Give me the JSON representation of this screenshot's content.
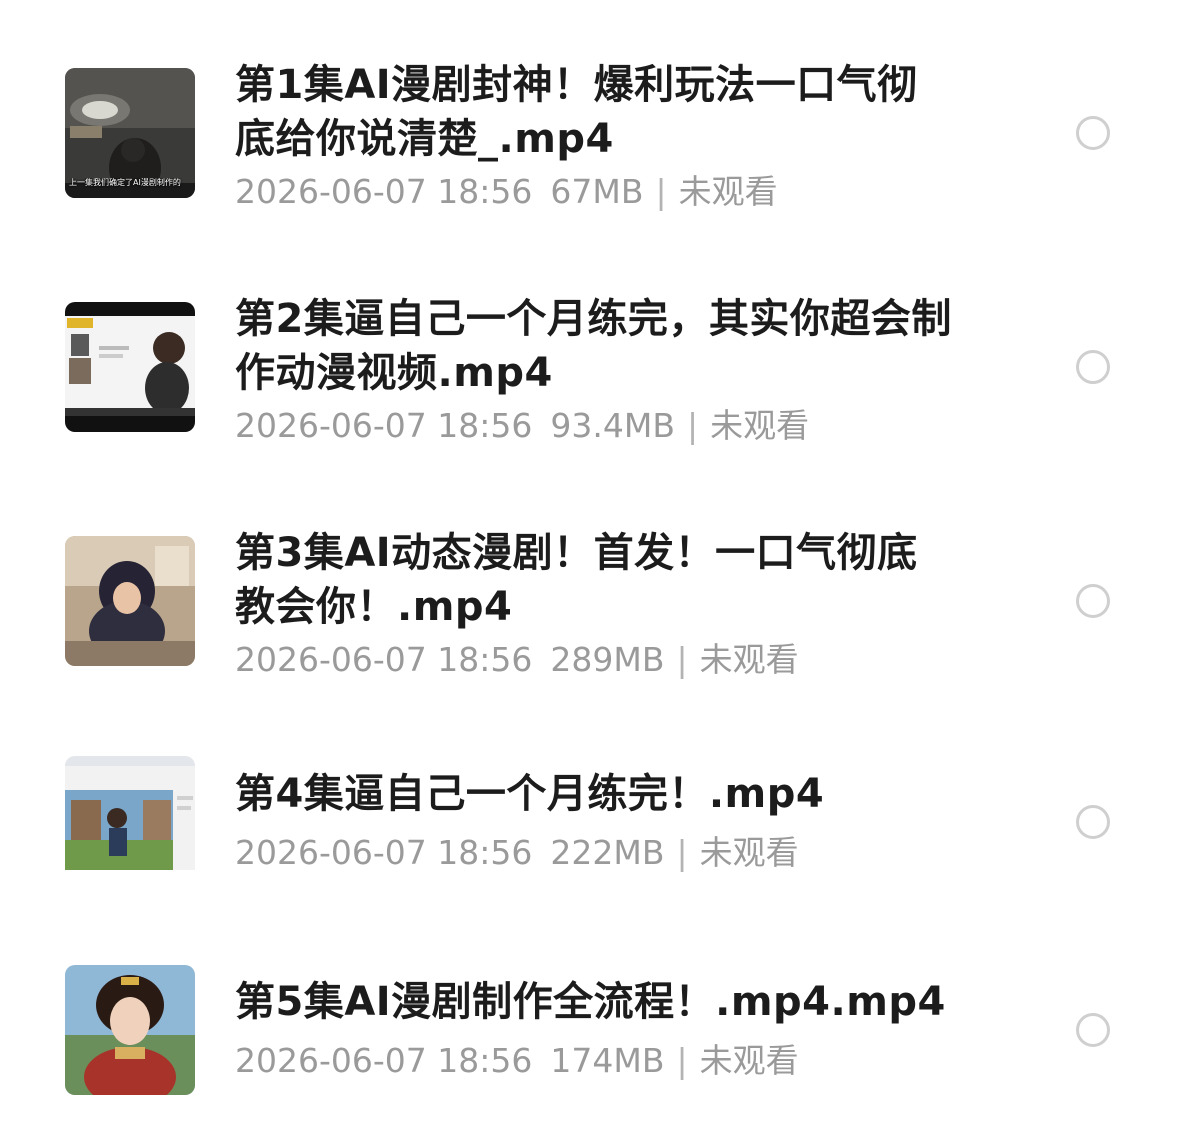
{
  "files": [
    {
      "title": "第1集AI漫剧封神！爆利玩法一口气彻底给你说清楚_.mp4",
      "date": "2026-06-07 18:56",
      "size": "67MB",
      "separator": "|",
      "status": "未观看",
      "thumb_caption": "上一集我们确定了AI漫剧制作的"
    },
    {
      "title": "第2集逼自己一个月练完，其实你超会制作动漫视频.mp4",
      "date": "2026-06-07 18:56",
      "size": "93.4MB",
      "separator": "|",
      "status": "未观看"
    },
    {
      "title": "第3集AI动态漫剧！首发！一口气彻底教会你！.mp4",
      "date": "2026-06-07 18:56",
      "size": "289MB",
      "separator": "|",
      "status": "未观看"
    },
    {
      "title": "第4集逼自己一个月练完！.mp4",
      "date": "2026-06-07 18:56",
      "size": "222MB",
      "separator": "|",
      "status": "未观看"
    },
    {
      "title": "第5集AI漫剧制作全流程！.mp4.mp4",
      "date": "2026-06-07 18:56",
      "size": "174MB",
      "separator": "|",
      "status": "未观看"
    }
  ]
}
